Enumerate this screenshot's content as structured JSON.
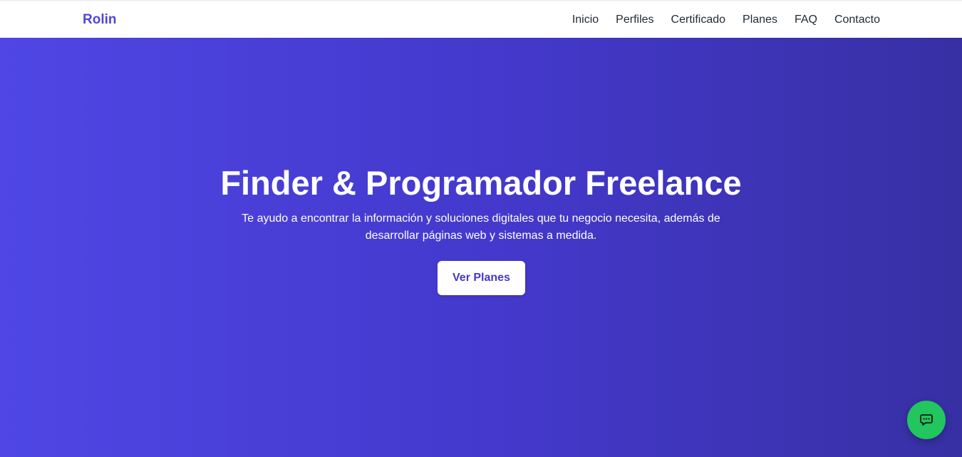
{
  "nav": {
    "brand": "Rolin",
    "links": [
      "Inicio",
      "Perfiles",
      "Certificado",
      "Planes",
      "FAQ",
      "Contacto"
    ]
  },
  "hero": {
    "title": "Finder & Programador Freelance",
    "subtitle": "Te ayudo a encontrar la información y soluciones digitales que tu negocio necesita, además de desarrollar páginas web y sistemas a medida.",
    "cta_label": "Ver Planes"
  },
  "chat": {
    "icon": "chat-bubble-icon"
  },
  "colors": {
    "brand": "#4f46e5",
    "hero_gradient_start": "#4f46e5",
    "hero_gradient_end": "#3730a3",
    "chat_button": "#22c55e"
  }
}
